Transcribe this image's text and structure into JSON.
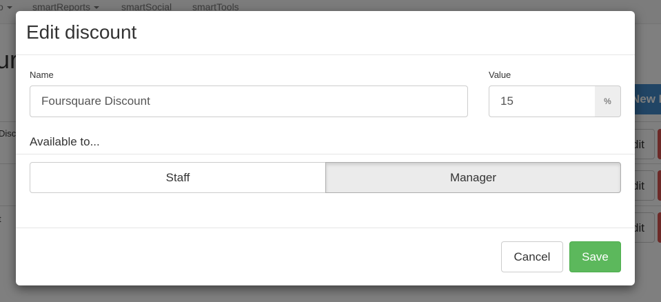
{
  "background": {
    "navbar": {
      "items": [
        {
          "label": "o",
          "has_caret": true
        },
        {
          "label": "smartReports",
          "has_caret": true
        },
        {
          "label": "smartSocial",
          "has_caret": false
        },
        {
          "label": "smartTools",
          "has_caret": false
        }
      ]
    },
    "page_title_fragment": "ur",
    "new_button_fragment": "New D",
    "rows": [
      {
        "cell_fragment": "Disc",
        "edit_label": "Edit"
      },
      {
        "cell_fragment": "",
        "edit_label": "Edit"
      },
      {
        "cell_fragment": "t",
        "edit_label": "Edit"
      }
    ]
  },
  "modal": {
    "title": "Edit discount",
    "name_label": "Name",
    "name_value": "Foursquare Discount",
    "value_label": "Value",
    "value_value": "15",
    "value_unit": "%",
    "available_label": "Available to...",
    "toggle_options": [
      {
        "label": "Staff",
        "active": false
      },
      {
        "label": "Manager",
        "active": true
      }
    ],
    "cancel_label": "Cancel",
    "save_label": "Save"
  },
  "colors": {
    "primary": "#428bca",
    "success": "#5cb85c",
    "danger": "#d9534f",
    "active_toggle": "#ebebeb"
  }
}
